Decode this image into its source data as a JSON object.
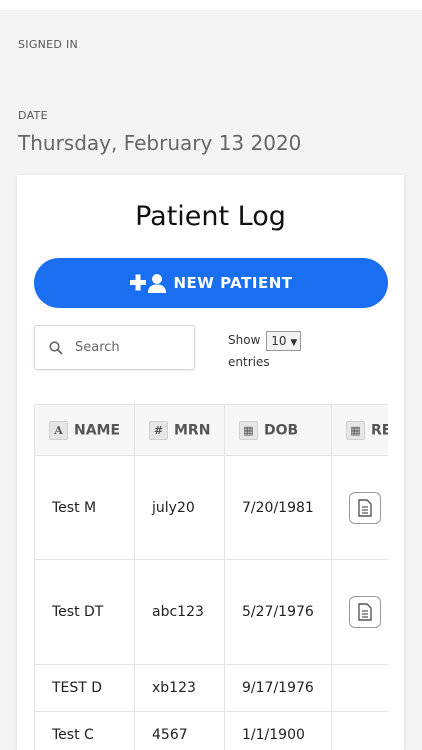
{
  "signed_in_label": "SIGNED IN",
  "date_label": "DATE",
  "date_value": "Thursday, February 13 2020",
  "card": {
    "title": "Patient Log",
    "new_patient_label": "NEW PATIENT",
    "search_placeholder": "Search",
    "show_label": "Show",
    "show_value": "10",
    "entries_label": "entries"
  },
  "table": {
    "columns": [
      {
        "icon": "text-icon",
        "glyph": "A",
        "label": "NAME"
      },
      {
        "icon": "hash-icon",
        "glyph": "#",
        "label": "MRN"
      },
      {
        "icon": "calendar-icon",
        "glyph": "▦",
        "label": "DOB"
      },
      {
        "icon": "calendar-icon",
        "glyph": "▦",
        "label": "REPORT"
      }
    ],
    "rows": [
      {
        "name": "Test M",
        "mrn": "july20",
        "dob": "7/20/1981",
        "has_report": true
      },
      {
        "name": "Test DT",
        "mrn": "abc123",
        "dob": "5/27/1976",
        "has_report": true
      },
      {
        "name": "TEST D",
        "mrn": "xb123",
        "dob": "9/17/1976",
        "has_report": false
      },
      {
        "name": "Test C",
        "mrn": "4567",
        "dob": "1/1/1900",
        "has_report": false
      }
    ]
  },
  "colors": {
    "accent": "#1a6ff0",
    "background": "#f4f4f4"
  }
}
